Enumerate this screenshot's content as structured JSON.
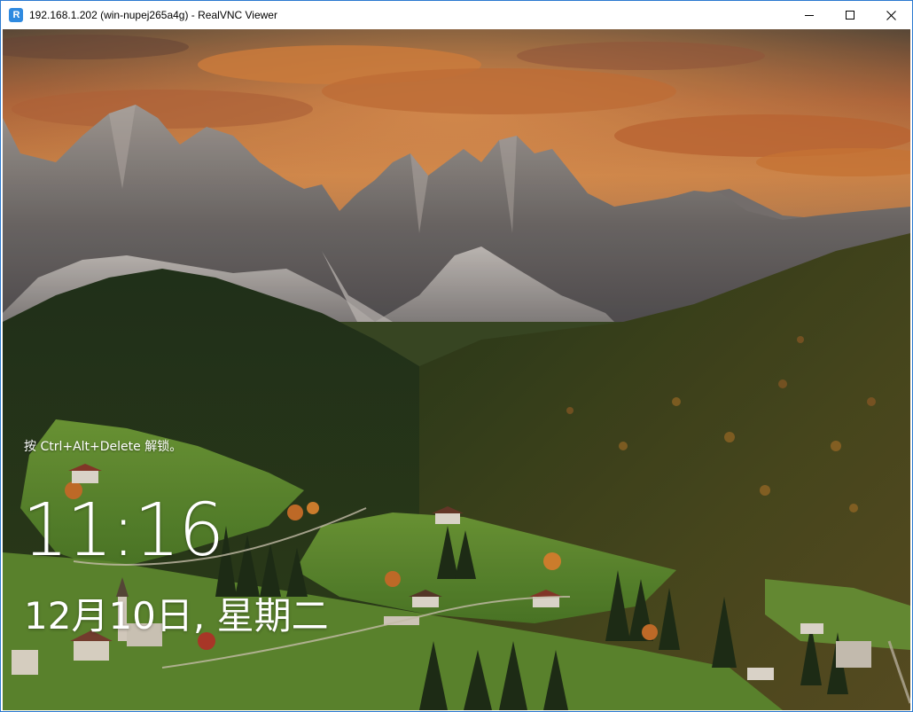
{
  "window": {
    "title": "192.168.1.202 (win-nupej265a4g) - RealVNC Viewer",
    "app_icon_label": "R",
    "minimize_icon": "minimize-icon",
    "maximize_icon": "maximize-icon",
    "close_icon": "close-icon"
  },
  "lock_screen": {
    "hint": "按 Ctrl+Alt+Delete 解锁。",
    "time": "11:16",
    "date": "12月10日, 星期二"
  },
  "colors": {
    "accent_border": "#2b79d0",
    "app_icon": "#2f8ae0",
    "text_on_wallpaper": "#ffffff"
  }
}
